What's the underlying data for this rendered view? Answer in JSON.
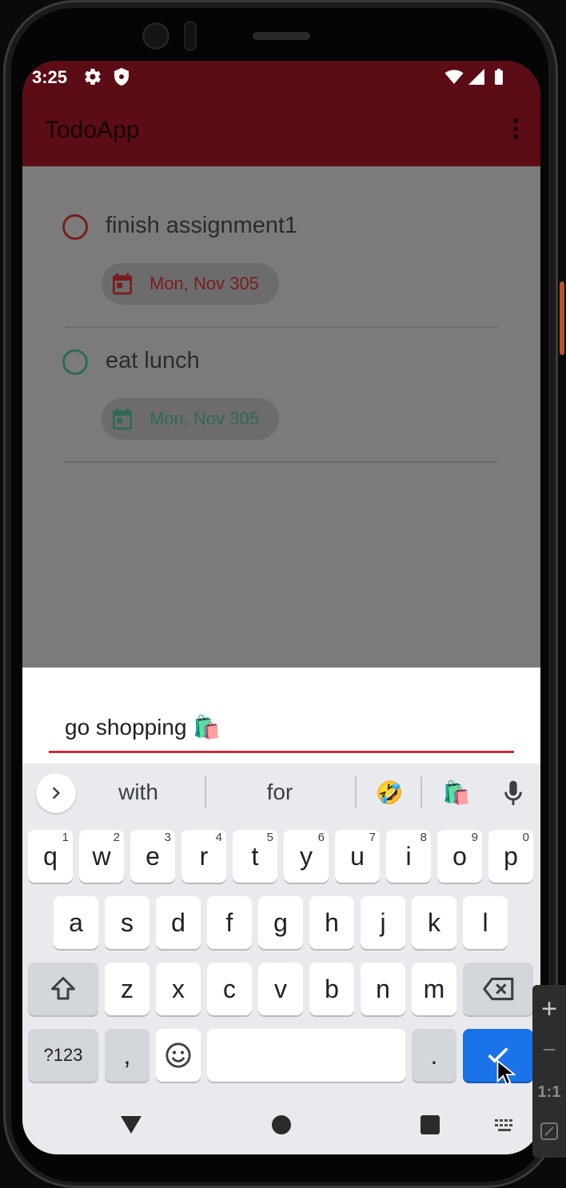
{
  "status_bar": {
    "time": "3:25",
    "icons": [
      "gear-icon",
      "shield-icon",
      "wifi-icon",
      "signal-icon",
      "battery-icon"
    ]
  },
  "app_bar": {
    "title": "TodoApp",
    "menu_icon": "more-vert-icon"
  },
  "todos": [
    {
      "title": "finish assignment1",
      "date": "Mon, Nov 305",
      "color": "#7a1d1d"
    },
    {
      "title": "eat lunch",
      "date": "Mon, Nov 305",
      "color": "#2f6a55"
    }
  ],
  "input": {
    "value": "go shopping 🛍️",
    "accent": "#c8323c"
  },
  "keyboard": {
    "suggestions": [
      "with",
      "for",
      "🤣",
      "🛍️"
    ],
    "rows": [
      [
        {
          "label": "q",
          "hint": "1"
        },
        {
          "label": "w",
          "hint": "2"
        },
        {
          "label": "e",
          "hint": "3"
        },
        {
          "label": "r",
          "hint": "4"
        },
        {
          "label": "t",
          "hint": "5"
        },
        {
          "label": "y",
          "hint": "6"
        },
        {
          "label": "u",
          "hint": "7"
        },
        {
          "label": "i",
          "hint": "8"
        },
        {
          "label": "o",
          "hint": "9"
        },
        {
          "label": "p",
          "hint": "0"
        }
      ],
      [
        {
          "label": "a"
        },
        {
          "label": "s"
        },
        {
          "label": "d"
        },
        {
          "label": "f"
        },
        {
          "label": "g"
        },
        {
          "label": "h"
        },
        {
          "label": "j"
        },
        {
          "label": "k"
        },
        {
          "label": "l"
        }
      ],
      [
        {
          "label": "z"
        },
        {
          "label": "x"
        },
        {
          "label": "c"
        },
        {
          "label": "v"
        },
        {
          "label": "b"
        },
        {
          "label": "n"
        },
        {
          "label": "m"
        }
      ]
    ],
    "symbols_label": "?123",
    "comma_label": ",",
    "period_label": ".",
    "accent": "#1a73e8"
  },
  "emulator_panel": {
    "zoom_in": "+",
    "zoom_out": "−",
    "actual_size": "1:1"
  }
}
